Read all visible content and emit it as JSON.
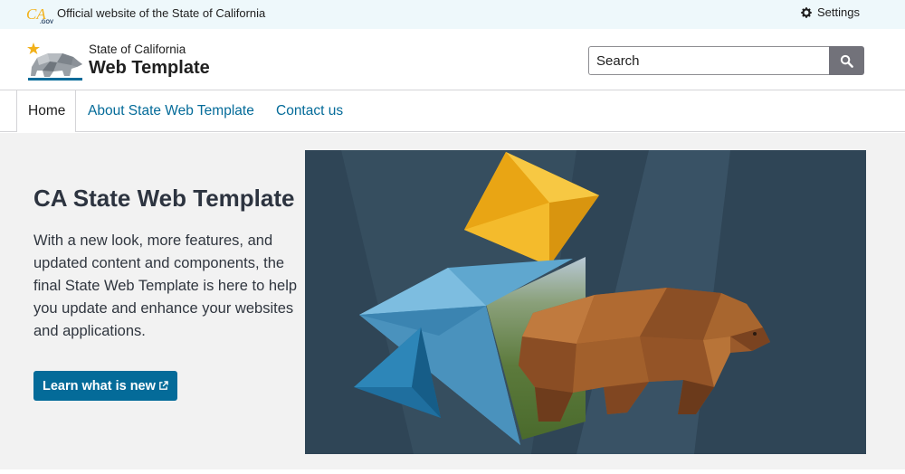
{
  "utility": {
    "official_text": "Official website of the State of California",
    "settings_label": "Settings",
    "logo_icon": "ca-gov-logo"
  },
  "branding": {
    "state_label": "State of California",
    "site_name": "Web Template",
    "logo_icon": "ca-bear-logo"
  },
  "search": {
    "placeholder": "Search",
    "button_icon": "search-icon"
  },
  "nav": {
    "items": [
      {
        "label": "Home",
        "active": true
      },
      {
        "label": "About State Web Template",
        "active": false
      },
      {
        "label": "Contact us",
        "active": false
      }
    ]
  },
  "hero": {
    "title": "CA State Web Template",
    "body": "With a new look, more features, and updated content and components, the final State Web Template is here to help you update and enhance your websites and applications.",
    "button_label": "Learn what is new",
    "button_icon": "external-link-icon",
    "image": "polygonal-bear-and-shapes-illustration"
  },
  "colors": {
    "utility_bg": "#eef8fb",
    "link": "#046b99",
    "button_bg": "#046b99",
    "hero_bg": "#f2f2f2",
    "image_bg": "#2f4556",
    "search_button": "#72727a"
  }
}
